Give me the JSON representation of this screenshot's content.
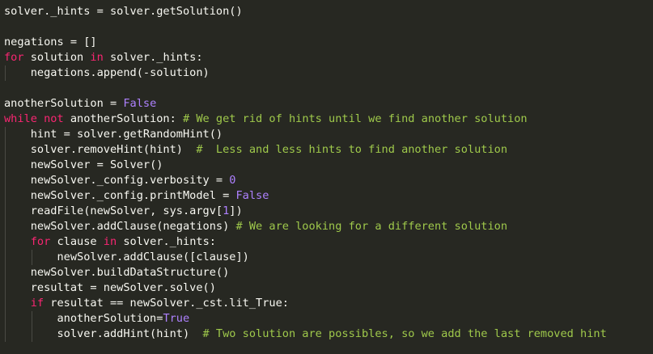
{
  "editor": {
    "lines": [
      {
        "indent": 0,
        "tokens": [
          {
            "t": "solver._hints = solver.getSolution()",
            "c": "plain"
          }
        ]
      },
      {
        "indent": 0,
        "tokens": []
      },
      {
        "indent": 0,
        "tokens": [
          {
            "t": "negations = []",
            "c": "plain"
          }
        ]
      },
      {
        "indent": 0,
        "tokens": [
          {
            "t": "for",
            "c": "kw"
          },
          {
            "t": " solution ",
            "c": "plain"
          },
          {
            "t": "in",
            "c": "kw"
          },
          {
            "t": " solver._hints:",
            "c": "plain"
          }
        ]
      },
      {
        "indent": 1,
        "tokens": [
          {
            "t": "negations.append(-solution)",
            "c": "plain"
          }
        ]
      },
      {
        "indent": 0,
        "tokens": []
      },
      {
        "indent": 0,
        "tokens": [
          {
            "t": "anotherSolution = ",
            "c": "plain"
          },
          {
            "t": "False",
            "c": "const"
          }
        ]
      },
      {
        "indent": 0,
        "tokens": [
          {
            "t": "while",
            "c": "kw"
          },
          {
            "t": " ",
            "c": "plain"
          },
          {
            "t": "not",
            "c": "kw"
          },
          {
            "t": " anotherSolution: ",
            "c": "plain"
          },
          {
            "t": "# We get rid of hints until we find another solution",
            "c": "cmt"
          }
        ]
      },
      {
        "indent": 1,
        "tokens": [
          {
            "t": "hint = solver.getRandomHint()",
            "c": "plain"
          }
        ]
      },
      {
        "indent": 1,
        "tokens": [
          {
            "t": "solver.removeHint(hint)  ",
            "c": "plain"
          },
          {
            "t": "#  Less and less hints to find another solution",
            "c": "cmt"
          }
        ]
      },
      {
        "indent": 1,
        "tokens": [
          {
            "t": "newSolver = Solver()",
            "c": "plain"
          }
        ]
      },
      {
        "indent": 1,
        "tokens": [
          {
            "t": "newSolver._config.verbosity = ",
            "c": "plain"
          },
          {
            "t": "0",
            "c": "const"
          }
        ]
      },
      {
        "indent": 1,
        "tokens": [
          {
            "t": "newSolver._config.printModel = ",
            "c": "plain"
          },
          {
            "t": "False",
            "c": "const"
          }
        ]
      },
      {
        "indent": 1,
        "tokens": [
          {
            "t": "readFile(newSolver, sys.argv[",
            "c": "plain"
          },
          {
            "t": "1",
            "c": "const"
          },
          {
            "t": "])",
            "c": "plain"
          }
        ]
      },
      {
        "indent": 1,
        "tokens": [
          {
            "t": "newSolver.addClause(negations) ",
            "c": "plain"
          },
          {
            "t": "# We are looking for a different solution",
            "c": "cmt"
          }
        ]
      },
      {
        "indent": 1,
        "tokens": [
          {
            "t": "for",
            "c": "kw"
          },
          {
            "t": " clause ",
            "c": "plain"
          },
          {
            "t": "in",
            "c": "kw"
          },
          {
            "t": " solver._hints:",
            "c": "plain"
          }
        ]
      },
      {
        "indent": 2,
        "tokens": [
          {
            "t": "newSolver.addClause([clause])",
            "c": "plain"
          }
        ]
      },
      {
        "indent": 1,
        "tokens": [
          {
            "t": "newSolver.buildDataStructure()",
            "c": "plain"
          }
        ]
      },
      {
        "indent": 1,
        "tokens": [
          {
            "t": "resultat = newSolver.solve()",
            "c": "plain"
          }
        ]
      },
      {
        "indent": 1,
        "tokens": [
          {
            "t": "if",
            "c": "kw"
          },
          {
            "t": " resultat == newSolver._cst.lit_True:",
            "c": "plain"
          }
        ]
      },
      {
        "indent": 2,
        "tokens": [
          {
            "t": "anotherSolution=",
            "c": "plain"
          },
          {
            "t": "True",
            "c": "const"
          }
        ]
      },
      {
        "indent": 2,
        "tokens": [
          {
            "t": "solver.addHint(hint)  ",
            "c": "plain"
          },
          {
            "t": "# Two solution are possibles, so we add the last removed hint",
            "c": "cmt"
          }
        ]
      }
    ],
    "colors": {
      "background": "#272822",
      "plain": "#f8f8f2",
      "keyword": "#f92672",
      "constant": "#ae81ff",
      "comment": "#9fc94b",
      "indent_guide": "#4a4a44"
    }
  }
}
